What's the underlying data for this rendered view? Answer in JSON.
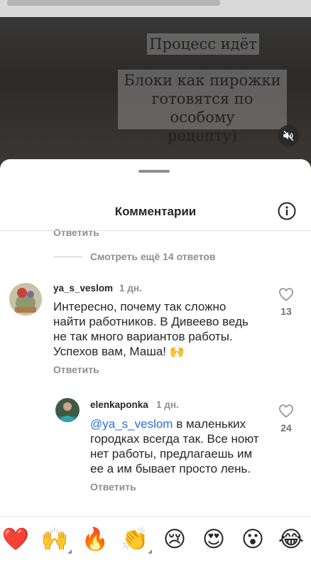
{
  "video": {
    "overlay_line1": "Процесс идёт",
    "overlay_line2": [
      "Блоки как пирожки",
      "готовятся по особому",
      "рецепту)"
    ],
    "mute_icon": "speaker-muted-icon"
  },
  "sheet": {
    "title": "Комментарии",
    "info_icon": "info-icon"
  },
  "cut_reply_label": "Ответить",
  "view_more": "Смотреть ещё 14 ответов",
  "comments": [
    {
      "username": "ya_s_veslom",
      "time": "1 дн.",
      "lines": [
        "Интересно, почему так сложно",
        "найти работников. В Дивеево ведь",
        "не так много вариантов работы.",
        "Успехов вам, Маша! 🙌"
      ],
      "reply_label": "Ответить",
      "likes": "13"
    },
    {
      "username": "elenkaponka",
      "time": "1 дн.",
      "mention": "@ya_s_veslom",
      "lines": [
        " в маленьких",
        "городках всегда так. Все ноют",
        "нет работы, предлагаешь им",
        "ее а им бывает просто лень."
      ],
      "reply_label": "Ответить",
      "likes": "24"
    }
  ],
  "emoji_bar": [
    "❤️",
    "🙌",
    "🔥",
    "👏",
    "😢",
    "😍",
    "😮",
    "😂"
  ],
  "colors": {
    "mention": "#2c6fd6",
    "heart_red": "#ed1c24"
  }
}
